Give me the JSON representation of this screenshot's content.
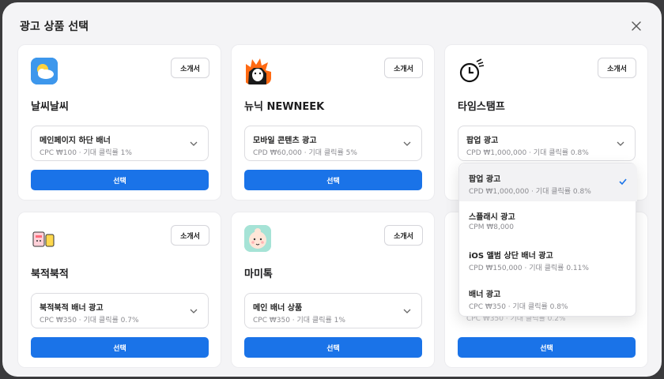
{
  "modal": {
    "title": "광고 상품 선택",
    "close_icon": "close-icon"
  },
  "colors": {
    "accent": "#1a73e8",
    "card_bg": "#ffffff",
    "modal_bg": "#f4f4f6"
  },
  "cards": [
    {
      "brand": "날씨날씨",
      "logo_icon": "weather-app-icon",
      "intro": "소개서",
      "product_name": "메인페이지 하단 배너",
      "product_meta": "CPC ₩100 · 기대 클릭률 1%",
      "choose": "선택"
    },
    {
      "brand": "뉴닉 NEWNEEK",
      "logo_icon": "newneek-hedgehog-icon",
      "intro": "소개서",
      "product_name": "모바일 콘텐츠 광고",
      "product_meta": "CPD ₩60,000 · 기대 클릭률 5%",
      "choose": "선택"
    },
    {
      "brand": "타임스탬프",
      "logo_icon": "timestamp-clock-icon",
      "intro": "소개서",
      "product_name": "팝업 광고",
      "product_meta": "CPD ₩1,000,000 · 기대 클릭률 0.8%",
      "choose": "선택"
    },
    {
      "brand": "북적북적",
      "logo_icon": "books-icon",
      "intro": "소개서",
      "product_name": "북적북적 배너 광고",
      "product_meta": "CPC ₩350 · 기대 클릭률 0.7%",
      "choose": "선택"
    },
    {
      "brand": "마미톡",
      "logo_icon": "baby-face-icon",
      "intro": "소개서",
      "product_name": "메인 배너 상품",
      "product_meta": "CPC ₩350 · 기대 클릭률 1%",
      "choose": "선택"
    },
    {
      "partial_meta": "CPC ₩350 · 기대 클릭률 0.2%",
      "choose": "선택"
    }
  ],
  "dropdown": {
    "options": [
      {
        "name": "팝업 광고",
        "meta": "CPD ₩1,000,000 · 기대 클릭률 0.8%",
        "selected": true
      },
      {
        "name": "스플래시 광고",
        "meta": "CPM ₩8,000",
        "selected": false
      },
      {
        "name": "iOS 앨범 상단 배너 광고",
        "meta": "CPD ₩150,000 · 기대 클릭률 0.11%",
        "selected": false
      },
      {
        "name": "배너 광고",
        "meta": "CPC ₩350 · 기대 클릭률 0.8%",
        "selected": false
      }
    ]
  }
}
